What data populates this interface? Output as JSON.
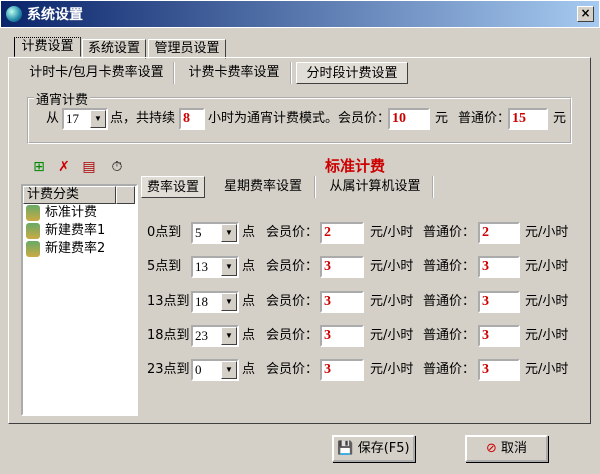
{
  "window": {
    "title": "系统设置",
    "close": "×"
  },
  "main_tabs": [
    "计费设置",
    "系统设置",
    "管理员设置"
  ],
  "sub_tabs": [
    "计时卡/包月卡费率设置",
    "计费卡费率设置",
    "分时段计费设置"
  ],
  "overnight": {
    "legend": "通宵计费",
    "from_label": "从",
    "from_value": "17",
    "point_label": "点，共持续",
    "duration": "8",
    "mode_label": "小时为通宵计费模式。会员价：",
    "member_price": "10",
    "yuan": "元",
    "normal_label": "普通价：",
    "normal_price": "15",
    "yuan2": "元"
  },
  "toolbar": [
    "add-rate-icon",
    "delete-rate-icon",
    "save-copy-icon",
    "timer-icon"
  ],
  "plan_title": "标准计费",
  "category": {
    "header": "计费分类",
    "items": [
      "标准计费",
      "新建费率1",
      "新建费率2"
    ]
  },
  "rate_tabs": [
    "费率设置",
    "星期费率设置",
    "从属计算机设置"
  ],
  "rates": {
    "point": "点",
    "member_label": "会员价：",
    "normal_label": "普通价：",
    "unit": "元/小时",
    "rows": [
      {
        "label": "0点到",
        "to": "5",
        "member": "2",
        "normal": "2"
      },
      {
        "label": "5点到",
        "to": "13",
        "member": "3",
        "normal": "3"
      },
      {
        "label": "13点到",
        "to": "18",
        "member": "3",
        "normal": "3"
      },
      {
        "label": "18点到",
        "to": "23",
        "member": "3",
        "normal": "3"
      },
      {
        "label": "23点到",
        "to": "0",
        "member": "3",
        "normal": "3"
      }
    ]
  },
  "buttons": {
    "save": "保存(F5)",
    "cancel": "取消"
  },
  "colors": {
    "accent_red": "#cc0000",
    "title_bar": "#0a246a"
  }
}
